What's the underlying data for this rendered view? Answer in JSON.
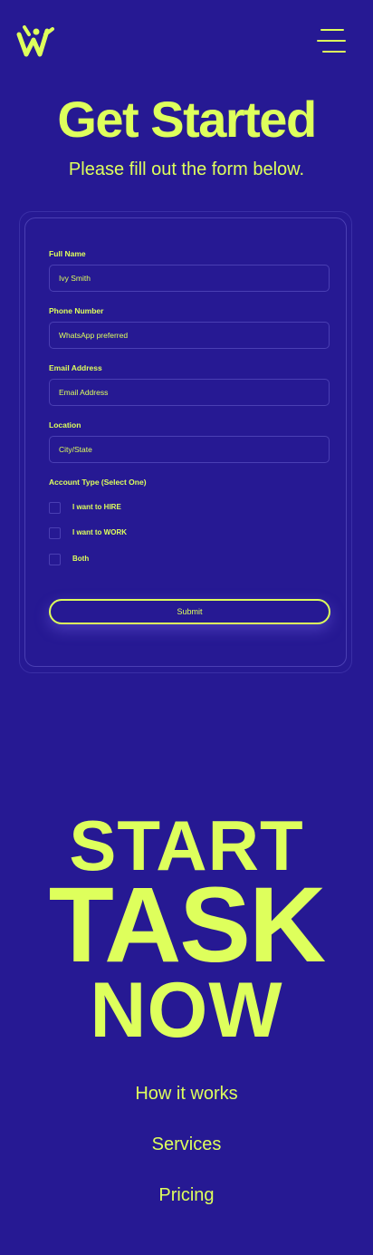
{
  "header": {
    "logo_icon": "w-logo-icon",
    "menu_icon": "hamburger-menu-icon"
  },
  "hero": {
    "title": "Get Started",
    "subtitle": "Please fill out the form below."
  },
  "form": {
    "fields": [
      {
        "label": "Full Name",
        "value": "Ivy Smith",
        "placeholder": ""
      },
      {
        "label": "Phone Number",
        "value": "",
        "placeholder": "WhatsApp preferred"
      },
      {
        "label": "Email Address",
        "value": "",
        "placeholder": "Email Address"
      },
      {
        "label": "Location",
        "value": "",
        "placeholder": "City/State"
      }
    ],
    "account_type_label": "Account Type (Select One)",
    "options": [
      "I want to HIRE",
      "I want to WORK",
      "Both"
    ],
    "submit_label": "Submit"
  },
  "cta": {
    "line1": "START",
    "line2": "TASK",
    "line3": "NOW"
  },
  "footer_nav": [
    "How it works",
    "Services",
    "Pricing"
  ],
  "colors": {
    "background": "#261993",
    "accent": "#DEFF5C"
  }
}
